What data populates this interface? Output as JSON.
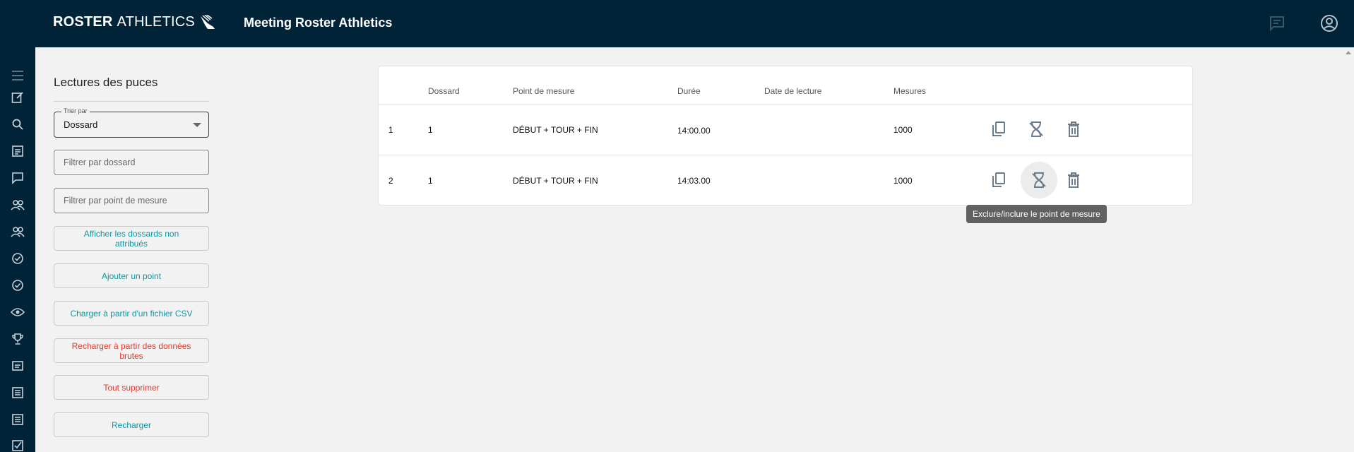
{
  "header": {
    "logo_bold": "ROSTER",
    "logo_thin": "ATHLETICS",
    "app_title": "Meeting Roster Athletics",
    "icons": [
      "comment-icon",
      "account-circle-icon"
    ]
  },
  "rail": {
    "icons": [
      "menu-icon",
      "edit-icon",
      "search-icon",
      "list-icon",
      "comment-icon",
      "group-icon",
      "group-icon",
      "check-circle-icon",
      "check-circle-icon",
      "eye-icon",
      "trophy-icon",
      "badge-icon",
      "list-alt-icon",
      "list-alt-icon",
      "checkbox-icon"
    ]
  },
  "panel": {
    "title": "Lectures des puces",
    "sort": {
      "label": "Trier par",
      "value": "Dossard"
    },
    "filter_bib_placeholder": "Filtrer par dossard",
    "filter_point_placeholder": "Filtrer par point de mesure",
    "buttons": {
      "show_unassigned": "Afficher les dossards non attribués",
      "add_point": "Ajouter un point",
      "load_csv": "Charger à partir d'un fichier CSV",
      "reload_raw": "Recharger à partir des données brutes",
      "delete_all": "Tout supprimer",
      "reload": "Recharger"
    }
  },
  "table": {
    "columns": [
      "Dossard",
      "Point de mesure",
      "Durée",
      "Date de lecture",
      "Mesures"
    ],
    "rows": [
      {
        "index": "1",
        "dossard": "1",
        "point": "DÉBUT + TOUR + FIN",
        "duree": "14:00.00",
        "date": "",
        "mesures": "1000"
      },
      {
        "index": "2",
        "dossard": "1",
        "point": "DÉBUT + TOUR + FIN",
        "duree": "14:03.00",
        "date": "",
        "mesures": "1000"
      }
    ],
    "actions": [
      "copy-icon",
      "hourglass-disabled-icon",
      "delete-icon"
    ]
  },
  "tooltip": "Exclure/inclure le point de mesure",
  "colors": {
    "header_bg": "#012338",
    "accent_teal": "#0c97a2",
    "danger_red": "#e0392c",
    "action_icon": "#6b7d8c",
    "page_bg": "#f2f2f2"
  }
}
